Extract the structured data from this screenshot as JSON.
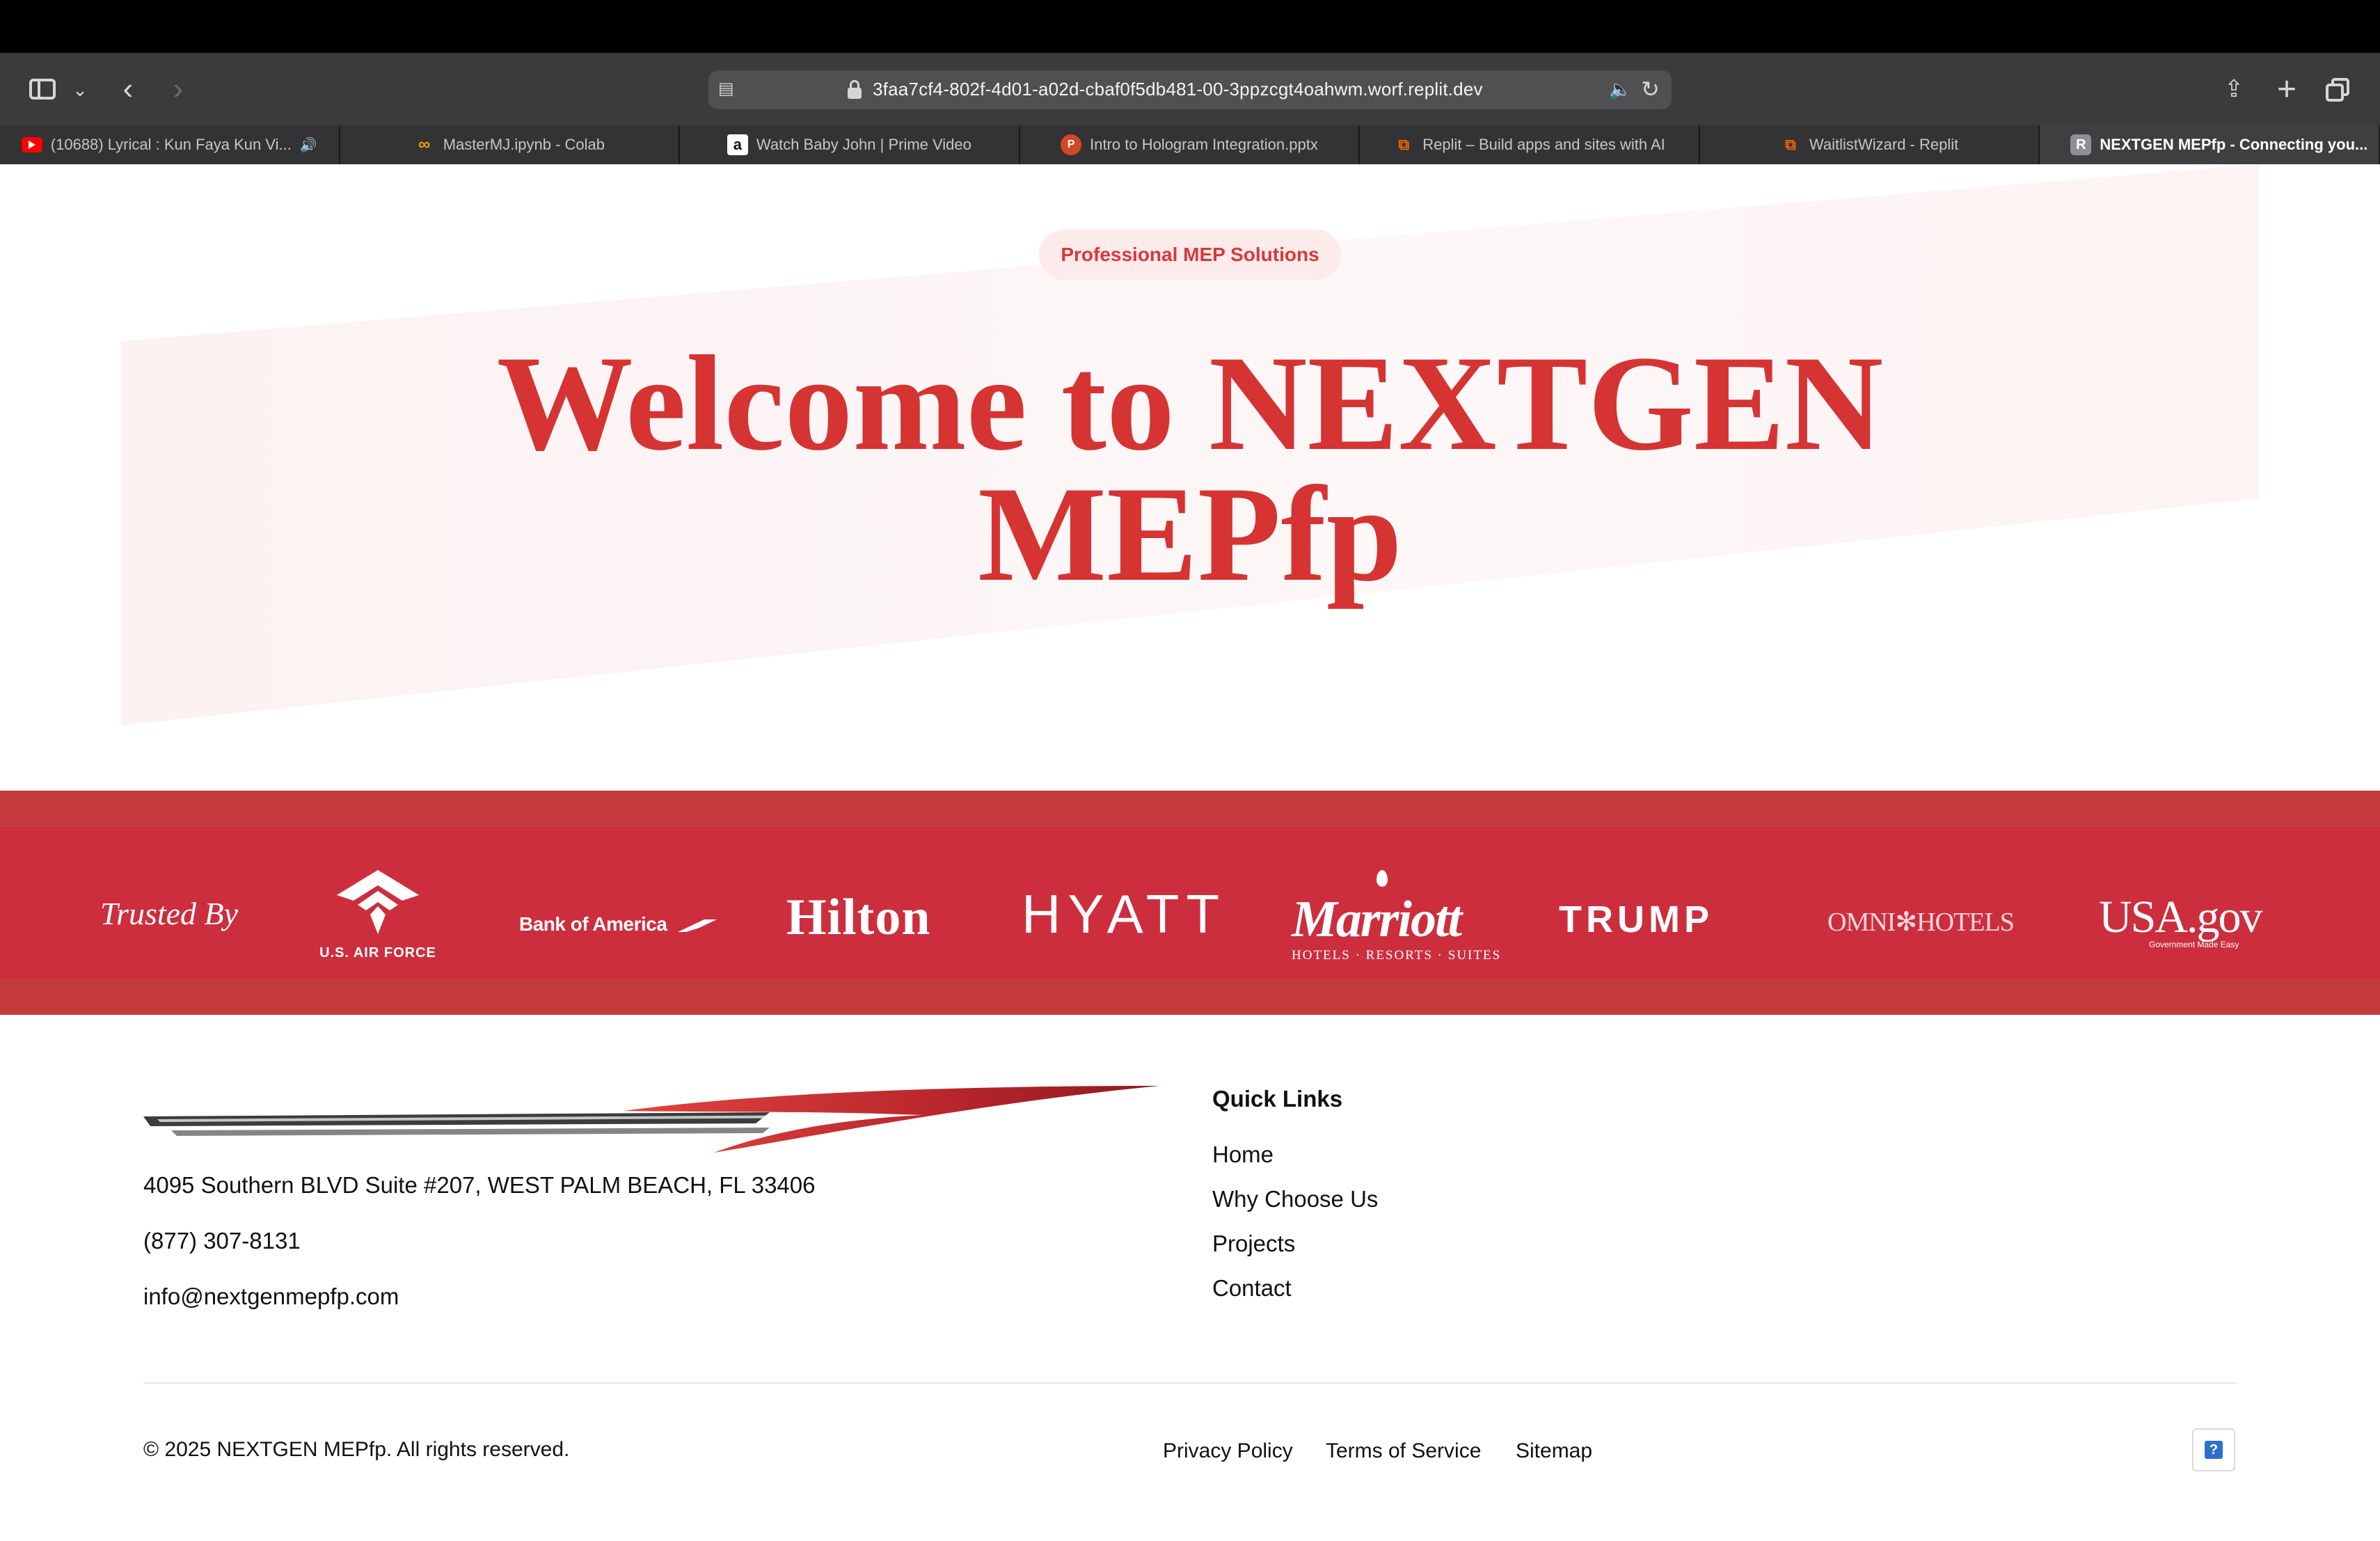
{
  "browser": {
    "url": "3faa7cf4-802f-4d01-a02d-cbaf0f5db481-00-3ppzcgt4oahwm.worf.replit.dev",
    "tabs": [
      {
        "label": "(10688) Lyrical : Kun Faya Kun Vi...",
        "icon": "youtube-icon"
      },
      {
        "label": "MasterMJ.ipynb - Colab",
        "icon": "colab-icon"
      },
      {
        "label": "Watch Baby John | Prime Video",
        "icon": "amazon-icon"
      },
      {
        "label": "Intro to Hologram Integration.pptx",
        "icon": "powerpoint-icon"
      },
      {
        "label": "Replit – Build apps and sites with AI",
        "icon": "replit-icon"
      },
      {
        "label": "WaitlistWizard - Replit",
        "icon": "replit-icon"
      },
      {
        "label": "NEXTGEN MEPfp - Connecting you...",
        "icon": "r-icon",
        "active": true
      }
    ]
  },
  "hero": {
    "badge": "Professional MEP Solutions",
    "title_line1": "Welcome to NEXTGEN",
    "title_line2": "MEPfp"
  },
  "trusted": {
    "label": "Trusted By",
    "logos": {
      "air_force": "U.S. AIR FORCE",
      "bank_of_america": "Bank of America",
      "hilton": "Hilton",
      "hyatt": "HYATT",
      "marriott": "Marriott",
      "marriott_sub": "HOTELS · RESORTS · SUITES",
      "trump": "TRUMP",
      "omni": "OMNI✻HOTELS",
      "usagov": "USA.gov",
      "usagov_tag": "Government Made Easy"
    }
  },
  "footer": {
    "address": "4095 Southern BLVD Suite #207, WEST PALM BEACH, FL 33406",
    "phone": "(877) 307-8131",
    "email": "info@nextgenmepfp.com",
    "quick_links_title": "Quick Links",
    "quick_links": [
      "Home",
      "Why Choose Us",
      "Projects",
      "Contact"
    ],
    "copyright": "© 2025 NEXTGEN MEPfp. All rights reserved.",
    "legal_links": [
      "Privacy Policy",
      "Terms of Service",
      "Sitemap"
    ],
    "help_label": "?"
  },
  "colors": {
    "brand_red": "#d63333",
    "band_red": "#cc2e3e",
    "badge_bg": "#fdeaea"
  }
}
